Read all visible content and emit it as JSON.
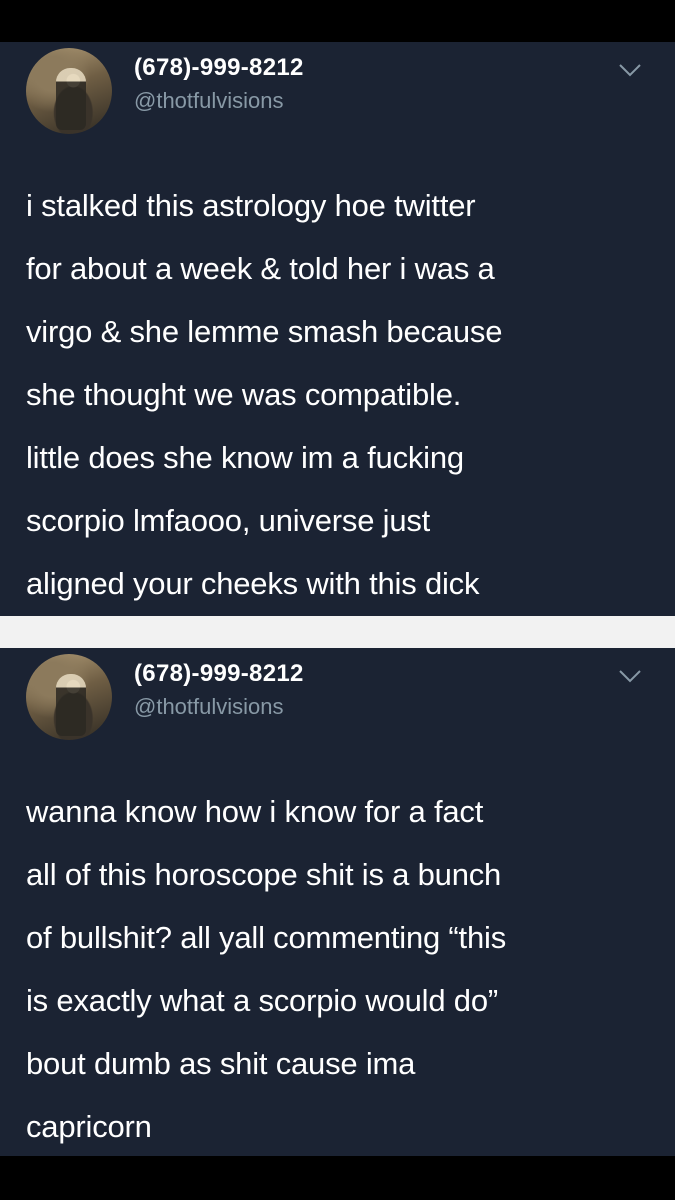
{
  "tweets": [
    {
      "display_name": "(678)-999-8212",
      "handle": "@thotfulvisions",
      "avatar_icon": "user-avatar-photo",
      "menu_icon": "chevron-down-icon",
      "text_lines": [
        "i stalked this astrology hoe twitter",
        "for about a week & told her i was a",
        "virgo & she lemme smash because",
        "she thought we was compatible.",
        "little does she know im a fucking",
        "scorpio lmfaooo, universe just",
        "aligned your cheeks with this dick"
      ]
    },
    {
      "display_name": "(678)-999-8212",
      "handle": "@thotfulvisions",
      "avatar_icon": "user-avatar-photo",
      "menu_icon": "chevron-down-icon",
      "text_lines": [
        "wanna know how i know for a fact",
        "all of this horoscope shit is a bunch",
        "of bullshit? all yall commenting “this",
        "is exactly what a scorpio would do”",
        "bout dumb as shit cause ima",
        "capricorn"
      ]
    }
  ],
  "colors": {
    "tweet_background": "#1b2333",
    "handle_text": "#8899a6",
    "divider": "#f2f2f2",
    "frame": "#000000"
  }
}
